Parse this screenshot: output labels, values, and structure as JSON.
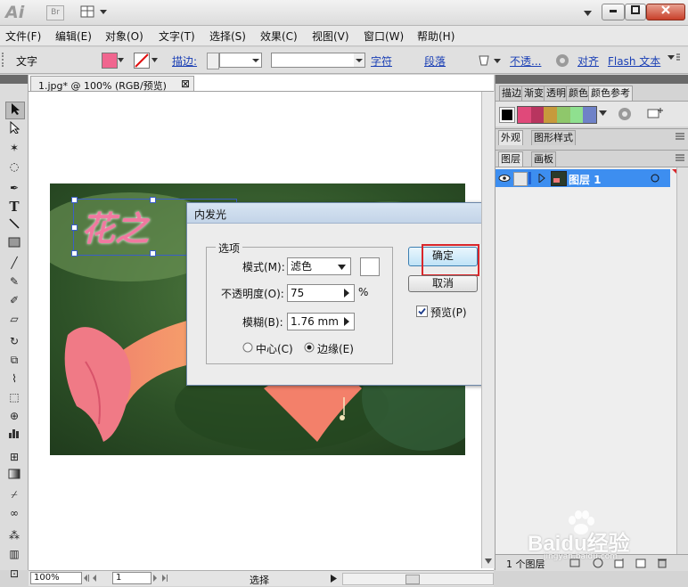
{
  "app": {
    "logo": "Ai",
    "bridge_label": "Br"
  },
  "menu": [
    "文件(F)",
    "编辑(E)",
    "对象(O)",
    "文字(T)",
    "选择(S)",
    "效果(C)",
    "视图(V)",
    "窗口(W)",
    "帮助(H)"
  ],
  "control_bar": {
    "tool_label": "文字",
    "stroke_label": "描边:",
    "char_link": "字符",
    "para_link": "段落",
    "opacity_link": "不透...",
    "align_link": "对齐",
    "flash_link": "Flash 文本"
  },
  "document": {
    "tab_title": "1.jpg* @ 100% (RGB/预览)",
    "close_glyph": "⊠"
  },
  "status_bar": {
    "zoom": "100%",
    "page": "1",
    "mode": "选择"
  },
  "dialog": {
    "title": "内发光",
    "group_label": "选项",
    "mode_label": "模式(M):",
    "mode_value": "滤色",
    "opacity_label": "不透明度(O):",
    "opacity_value": "75",
    "percent": "%",
    "blur_label": "模糊(B):",
    "blur_value": "1.76 mm",
    "center_label": "中心(C)",
    "edge_label": "边缘(E)",
    "ok_label": "确定",
    "cancel_label": "取消",
    "preview_label": "预览(P)",
    "preview_checked": true,
    "edge_selected": true
  },
  "artwork_text": "花之",
  "right_panel": {
    "top_tabs": [
      "描边",
      "渐变",
      "透明",
      "颜色",
      "颜色参考"
    ],
    "swatch_colors": [
      "#e0497a",
      "#b8355f",
      "#c79a3c",
      "#8fc76b",
      "#8fe08f",
      "#6f82c8"
    ],
    "appearance_tabs": [
      "外观",
      "图形样式"
    ],
    "layers_tabs": [
      "图层",
      "画板"
    ],
    "layer_name": "图层 1",
    "layer_count": "1 个图层"
  },
  "watermark": {
    "main": "Baidu经验",
    "sub": "jingyan.baidu.com"
  },
  "colors": {
    "fill_swatch": "#f0668f",
    "accent_red": "#d9262a",
    "layer_selected": "#3d8ef0"
  }
}
